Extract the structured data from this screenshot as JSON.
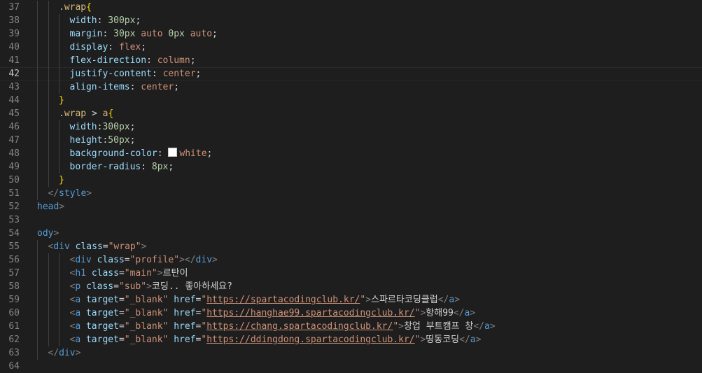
{
  "editor": {
    "current_line": 42,
    "lines": [
      {
        "n": 37,
        "indent": 2,
        "tokens": [
          {
            "t": ".wrap",
            "c": "sel"
          },
          {
            "t": "{",
            "c": "brace"
          }
        ]
      },
      {
        "n": 38,
        "indent": 3,
        "tokens": [
          {
            "t": "width",
            "c": "prop"
          },
          {
            "t": ": ",
            "c": "punc"
          },
          {
            "t": "300px",
            "c": "num"
          },
          {
            "t": ";",
            "c": "punc"
          }
        ]
      },
      {
        "n": 39,
        "indent": 3,
        "tokens": [
          {
            "t": "margin",
            "c": "prop"
          },
          {
            "t": ": ",
            "c": "punc"
          },
          {
            "t": "30px",
            "c": "num"
          },
          {
            "t": " ",
            "c": "punc"
          },
          {
            "t": "auto",
            "c": "val"
          },
          {
            "t": " ",
            "c": "punc"
          },
          {
            "t": "0px",
            "c": "num"
          },
          {
            "t": " ",
            "c": "punc"
          },
          {
            "t": "auto",
            "c": "val"
          },
          {
            "t": ";",
            "c": "punc"
          }
        ]
      },
      {
        "n": 40,
        "indent": 3,
        "tokens": [
          {
            "t": "display",
            "c": "prop"
          },
          {
            "t": ": ",
            "c": "punc"
          },
          {
            "t": "flex",
            "c": "val"
          },
          {
            "t": ";",
            "c": "punc"
          }
        ]
      },
      {
        "n": 41,
        "indent": 3,
        "tokens": [
          {
            "t": "flex-direction",
            "c": "prop"
          },
          {
            "t": ": ",
            "c": "punc"
          },
          {
            "t": "column",
            "c": "val"
          },
          {
            "t": ";",
            "c": "punc"
          }
        ]
      },
      {
        "n": 42,
        "indent": 3,
        "tokens": [
          {
            "t": "justify-content",
            "c": "prop"
          },
          {
            "t": ": ",
            "c": "punc"
          },
          {
            "t": "center",
            "c": "val"
          },
          {
            "t": ";",
            "c": "punc"
          }
        ]
      },
      {
        "n": 43,
        "indent": 3,
        "tokens": [
          {
            "t": "align-items",
            "c": "prop"
          },
          {
            "t": ": ",
            "c": "punc"
          },
          {
            "t": "center",
            "c": "val"
          },
          {
            "t": ";",
            "c": "punc"
          }
        ]
      },
      {
        "n": 44,
        "indent": 2,
        "tokens": [
          {
            "t": "}",
            "c": "brace"
          }
        ]
      },
      {
        "n": 45,
        "indent": 2,
        "tokens": [
          {
            "t": ".wrap",
            "c": "sel"
          },
          {
            "t": " > ",
            "c": "punc"
          },
          {
            "t": "a",
            "c": "sel"
          },
          {
            "t": "{",
            "c": "brace"
          }
        ]
      },
      {
        "n": 46,
        "indent": 3,
        "tokens": [
          {
            "t": "width",
            "c": "prop"
          },
          {
            "t": ":",
            "c": "punc"
          },
          {
            "t": "300px",
            "c": "num"
          },
          {
            "t": ";",
            "c": "punc"
          }
        ]
      },
      {
        "n": 47,
        "indent": 3,
        "tokens": [
          {
            "t": "height",
            "c": "prop"
          },
          {
            "t": ":",
            "c": "punc"
          },
          {
            "t": "50px",
            "c": "num"
          },
          {
            "t": ";",
            "c": "punc"
          }
        ]
      },
      {
        "n": 48,
        "indent": 3,
        "tokens": [
          {
            "t": "background-color",
            "c": "prop"
          },
          {
            "t": ": ",
            "c": "punc"
          },
          {
            "t": "",
            "c": "swatch"
          },
          {
            "t": "white",
            "c": "val"
          },
          {
            "t": ";",
            "c": "punc"
          }
        ]
      },
      {
        "n": 49,
        "indent": 3,
        "tokens": [
          {
            "t": "border-radius",
            "c": "prop"
          },
          {
            "t": ": ",
            "c": "punc"
          },
          {
            "t": "8px",
            "c": "num"
          },
          {
            "t": ";",
            "c": "punc"
          }
        ]
      },
      {
        "n": 50,
        "indent": 2,
        "tokens": [
          {
            "t": "}",
            "c": "brace"
          }
        ]
      },
      {
        "n": 51,
        "indent": 1,
        "tokens": [
          {
            "t": "</",
            "c": "ang"
          },
          {
            "t": "style",
            "c": "tag"
          },
          {
            "t": ">",
            "c": "ang"
          }
        ]
      },
      {
        "n": 52,
        "indent": 0,
        "tokens": [
          {
            "t": "head",
            "c": "tag"
          },
          {
            "t": ">",
            "c": "ang"
          }
        ]
      },
      {
        "n": 53,
        "indent": 0,
        "tokens": []
      },
      {
        "n": 54,
        "indent": 0,
        "tokens": [
          {
            "t": "ody",
            "c": "tag"
          },
          {
            "t": ">",
            "c": "ang"
          }
        ]
      },
      {
        "n": 55,
        "indent": 1,
        "tokens": [
          {
            "t": "<",
            "c": "ang"
          },
          {
            "t": "div",
            "c": "tag"
          },
          {
            "t": " ",
            "c": "punc"
          },
          {
            "t": "class",
            "c": "attr"
          },
          {
            "t": "=",
            "c": "punc"
          },
          {
            "t": "\"wrap\"",
            "c": "str"
          },
          {
            "t": ">",
            "c": "ang"
          }
        ]
      },
      {
        "n": 56,
        "indent": 3,
        "tokens": [
          {
            "t": "<",
            "c": "ang"
          },
          {
            "t": "div",
            "c": "tag"
          },
          {
            "t": " ",
            "c": "punc"
          },
          {
            "t": "class",
            "c": "attr"
          },
          {
            "t": "=",
            "c": "punc"
          },
          {
            "t": "\"profile\"",
            "c": "str"
          },
          {
            "t": "></",
            "c": "ang"
          },
          {
            "t": "div",
            "c": "tag"
          },
          {
            "t": ">",
            "c": "ang"
          }
        ]
      },
      {
        "n": 57,
        "indent": 3,
        "tokens": [
          {
            "t": "<",
            "c": "ang"
          },
          {
            "t": "h1",
            "c": "tag"
          },
          {
            "t": " ",
            "c": "punc"
          },
          {
            "t": "class",
            "c": "attr"
          },
          {
            "t": "=",
            "c": "punc"
          },
          {
            "t": "\"main\"",
            "c": "str"
          },
          {
            "t": ">",
            "c": "ang"
          },
          {
            "t": "르탄이",
            "c": "text"
          }
        ]
      },
      {
        "n": 58,
        "indent": 3,
        "tokens": [
          {
            "t": "<",
            "c": "ang"
          },
          {
            "t": "p",
            "c": "tag"
          },
          {
            "t": " ",
            "c": "punc"
          },
          {
            "t": "class",
            "c": "attr"
          },
          {
            "t": "=",
            "c": "punc"
          },
          {
            "t": "\"sub\"",
            "c": "str"
          },
          {
            "t": ">",
            "c": "ang"
          },
          {
            "t": "코딩.. 좋아하세요?",
            "c": "text"
          }
        ]
      },
      {
        "n": 59,
        "indent": 3,
        "tokens": [
          {
            "t": "<",
            "c": "ang"
          },
          {
            "t": "a",
            "c": "tag"
          },
          {
            "t": " ",
            "c": "punc"
          },
          {
            "t": "target",
            "c": "attr"
          },
          {
            "t": "=",
            "c": "punc"
          },
          {
            "t": "\"_blank\"",
            "c": "str"
          },
          {
            "t": " ",
            "c": "punc"
          },
          {
            "t": "href",
            "c": "attr"
          },
          {
            "t": "=",
            "c": "punc"
          },
          {
            "t": "\"",
            "c": "str"
          },
          {
            "t": "https://spartacodingclub.kr/",
            "c": "url"
          },
          {
            "t": "\"",
            "c": "str"
          },
          {
            "t": ">",
            "c": "ang"
          },
          {
            "t": "스파르타코딩클럽",
            "c": "text"
          },
          {
            "t": "</",
            "c": "ang"
          },
          {
            "t": "a",
            "c": "tag"
          },
          {
            "t": ">",
            "c": "ang"
          }
        ]
      },
      {
        "n": 60,
        "indent": 3,
        "tokens": [
          {
            "t": "<",
            "c": "ang"
          },
          {
            "t": "a",
            "c": "tag"
          },
          {
            "t": " ",
            "c": "punc"
          },
          {
            "t": "target",
            "c": "attr"
          },
          {
            "t": "=",
            "c": "punc"
          },
          {
            "t": "\"_blank\"",
            "c": "str"
          },
          {
            "t": " ",
            "c": "punc"
          },
          {
            "t": "href",
            "c": "attr"
          },
          {
            "t": "=",
            "c": "punc"
          },
          {
            "t": "\"",
            "c": "str"
          },
          {
            "t": "https://hanghae99.spartacodingclub.kr/",
            "c": "url"
          },
          {
            "t": "\"",
            "c": "str"
          },
          {
            "t": ">",
            "c": "ang"
          },
          {
            "t": "항해99",
            "c": "text"
          },
          {
            "t": "</",
            "c": "ang"
          },
          {
            "t": "a",
            "c": "tag"
          },
          {
            "t": ">",
            "c": "ang"
          }
        ]
      },
      {
        "n": 61,
        "indent": 3,
        "tokens": [
          {
            "t": "<",
            "c": "ang"
          },
          {
            "t": "a",
            "c": "tag"
          },
          {
            "t": " ",
            "c": "punc"
          },
          {
            "t": "target",
            "c": "attr"
          },
          {
            "t": "=",
            "c": "punc"
          },
          {
            "t": "\"_blank\"",
            "c": "str"
          },
          {
            "t": " ",
            "c": "punc"
          },
          {
            "t": "href",
            "c": "attr"
          },
          {
            "t": "=",
            "c": "punc"
          },
          {
            "t": "\"",
            "c": "str"
          },
          {
            "t": "https://chang.spartacodingclub.kr/",
            "c": "url"
          },
          {
            "t": "\"",
            "c": "str"
          },
          {
            "t": ">",
            "c": "ang"
          },
          {
            "t": "창업 부트캠프 창",
            "c": "text"
          },
          {
            "t": "</",
            "c": "ang"
          },
          {
            "t": "a",
            "c": "tag"
          },
          {
            "t": ">",
            "c": "ang"
          }
        ]
      },
      {
        "n": 62,
        "indent": 3,
        "tokens": [
          {
            "t": "<",
            "c": "ang"
          },
          {
            "t": "a",
            "c": "tag"
          },
          {
            "t": " ",
            "c": "punc"
          },
          {
            "t": "target",
            "c": "attr"
          },
          {
            "t": "=",
            "c": "punc"
          },
          {
            "t": "\"_blank\"",
            "c": "str"
          },
          {
            "t": " ",
            "c": "punc"
          },
          {
            "t": "href",
            "c": "attr"
          },
          {
            "t": "=",
            "c": "punc"
          },
          {
            "t": "\"",
            "c": "str"
          },
          {
            "t": "https://ddingdong.spartacodingclub.kr/",
            "c": "url"
          },
          {
            "t": "\"",
            "c": "str"
          },
          {
            "t": ">",
            "c": "ang"
          },
          {
            "t": "띵동코딩",
            "c": "text"
          },
          {
            "t": "</",
            "c": "ang"
          },
          {
            "t": "a",
            "c": "tag"
          },
          {
            "t": ">",
            "c": "ang"
          }
        ]
      },
      {
        "n": 63,
        "indent": 1,
        "tokens": [
          {
            "t": "</",
            "c": "ang"
          },
          {
            "t": "div",
            "c": "tag"
          },
          {
            "t": ">",
            "c": "ang"
          }
        ]
      },
      {
        "n": 64,
        "indent": 0,
        "tokens": []
      }
    ]
  },
  "colors": {
    "background": "#1e1e1e",
    "selector": "#d7ba7d",
    "brace": "#ffd700",
    "property": "#9cdcfe",
    "number": "#b5cea8",
    "string": "#ce9178",
    "tag": "#569cd6",
    "bracket": "#808080",
    "text": "#d4d4d4",
    "line_number": "#858585"
  }
}
